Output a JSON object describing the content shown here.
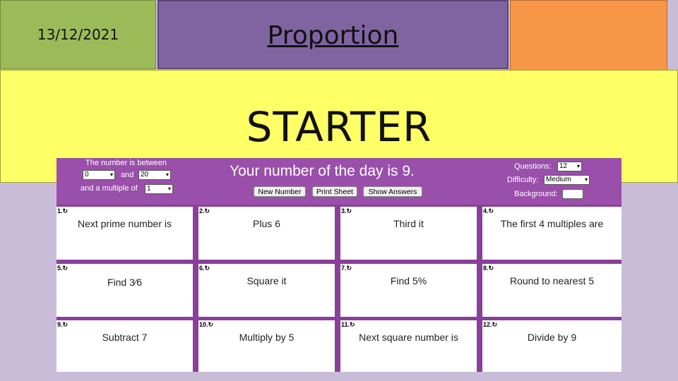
{
  "slide": {
    "date": "13/12/2021",
    "title": "Proportion",
    "heading": "STARTER"
  },
  "app": {
    "range_label": "The number is between",
    "range_from": "0",
    "and_label": "and",
    "range_to": "20",
    "multiple_label": "and a multiple of",
    "multiple_value": "1",
    "headline": "Your number of the day is 9.",
    "buttons": {
      "new_number": "New Number",
      "print_sheet": "Print Sheet",
      "show_answers": "Show Answers"
    },
    "questions_label": "Questions:",
    "questions_value": "12",
    "difficulty_label": "Difficulty:",
    "difficulty_value": "Medium",
    "background_label": "Background:"
  },
  "cards": [
    {
      "num": "1.↻",
      "text": "Next prime number is"
    },
    {
      "num": "2.↻",
      "text": "Plus 6"
    },
    {
      "num": "3.↻",
      "text": "Third it"
    },
    {
      "num": "4.↻",
      "text": "The first 4 multiples are"
    },
    {
      "num": "5.↻",
      "text": "Find ",
      "frac": "3⁄6"
    },
    {
      "num": "6.↻",
      "text": "Square it"
    },
    {
      "num": "7.↻",
      "text": "Find 5%"
    },
    {
      "num": "8.↻",
      "text": "Round to nearest 5"
    },
    {
      "num": "9.↻",
      "text": "Subtract 7"
    },
    {
      "num": "10.↻",
      "text": "Multiply by 5"
    },
    {
      "num": "11.↻",
      "text": "Next square number is"
    },
    {
      "num": "12.↻",
      "text": "Divide by 9"
    }
  ]
}
